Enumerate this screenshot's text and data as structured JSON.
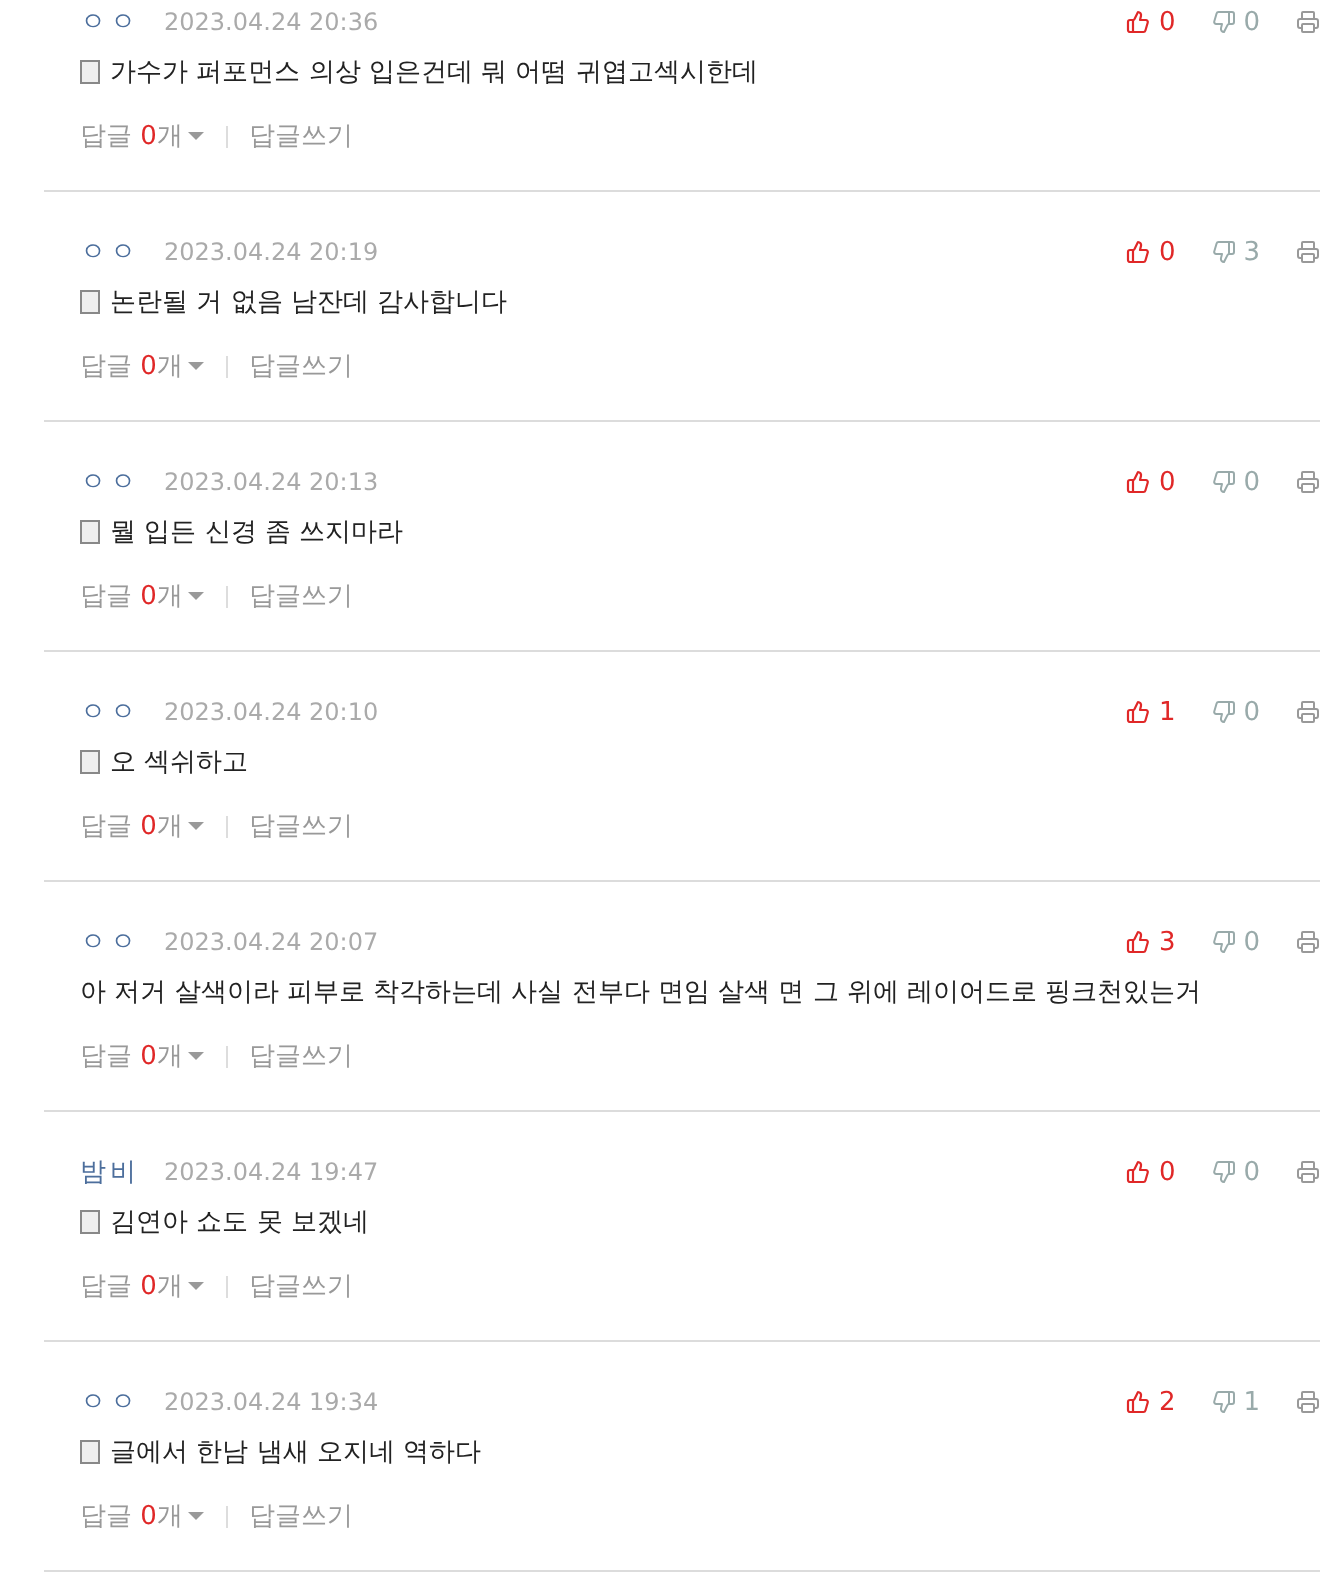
{
  "comments": [
    {
      "author": "ㅇㅇ",
      "date": "2023.04.24 20:36",
      "doc_icon": true,
      "text": "가수가 퍼포먼스 의상 입은건데 뭐 어떰 귀엽고섹시한데",
      "likes": "0",
      "dislikes": "0",
      "reply_label": "답글",
      "reply_count": "0",
      "reply_unit": "개",
      "write": "답글쓰기"
    },
    {
      "author": "ㅇㅇ",
      "date": "2023.04.24 20:19",
      "doc_icon": true,
      "text": "논란될 거 없음 남잔데 감사합니다",
      "likes": "0",
      "dislikes": "3",
      "reply_label": "답글",
      "reply_count": "0",
      "reply_unit": "개",
      "write": "답글쓰기"
    },
    {
      "author": "ㅇㅇ",
      "date": "2023.04.24 20:13",
      "doc_icon": true,
      "text": "뭘 입든 신경 좀 쓰지마라",
      "likes": "0",
      "dislikes": "0",
      "reply_label": "답글",
      "reply_count": "0",
      "reply_unit": "개",
      "write": "답글쓰기"
    },
    {
      "author": "ㅇㅇ",
      "date": "2023.04.24 20:10",
      "doc_icon": true,
      "text": "오 섹쉬하고",
      "likes": "1",
      "dislikes": "0",
      "reply_label": "답글",
      "reply_count": "0",
      "reply_unit": "개",
      "write": "답글쓰기"
    },
    {
      "author": "ㅇㅇ",
      "date": "2023.04.24 20:07",
      "doc_icon": false,
      "text": "아 저거 살색이라 피부로 착각하는데 사실 전부다 면임 살색 면 그 위에 레이어드로 핑크천있는거",
      "likes": "3",
      "dislikes": "0",
      "reply_label": "답글",
      "reply_count": "0",
      "reply_unit": "개",
      "write": "답글쓰기"
    },
    {
      "author": "밤비",
      "date": "2023.04.24 19:47",
      "doc_icon": true,
      "text": "김연아 쇼도 못 보겠네",
      "likes": "0",
      "dislikes": "0",
      "reply_label": "답글",
      "reply_count": "0",
      "reply_unit": "개",
      "write": "답글쓰기"
    },
    {
      "author": "ㅇㅇ",
      "date": "2023.04.24 19:34",
      "doc_icon": true,
      "text": "글에서 한남 냄새 오지네 역하다",
      "likes": "2",
      "dislikes": "1",
      "reply_label": "답글",
      "reply_count": "0",
      "reply_unit": "개",
      "write": "답글쓰기"
    }
  ]
}
